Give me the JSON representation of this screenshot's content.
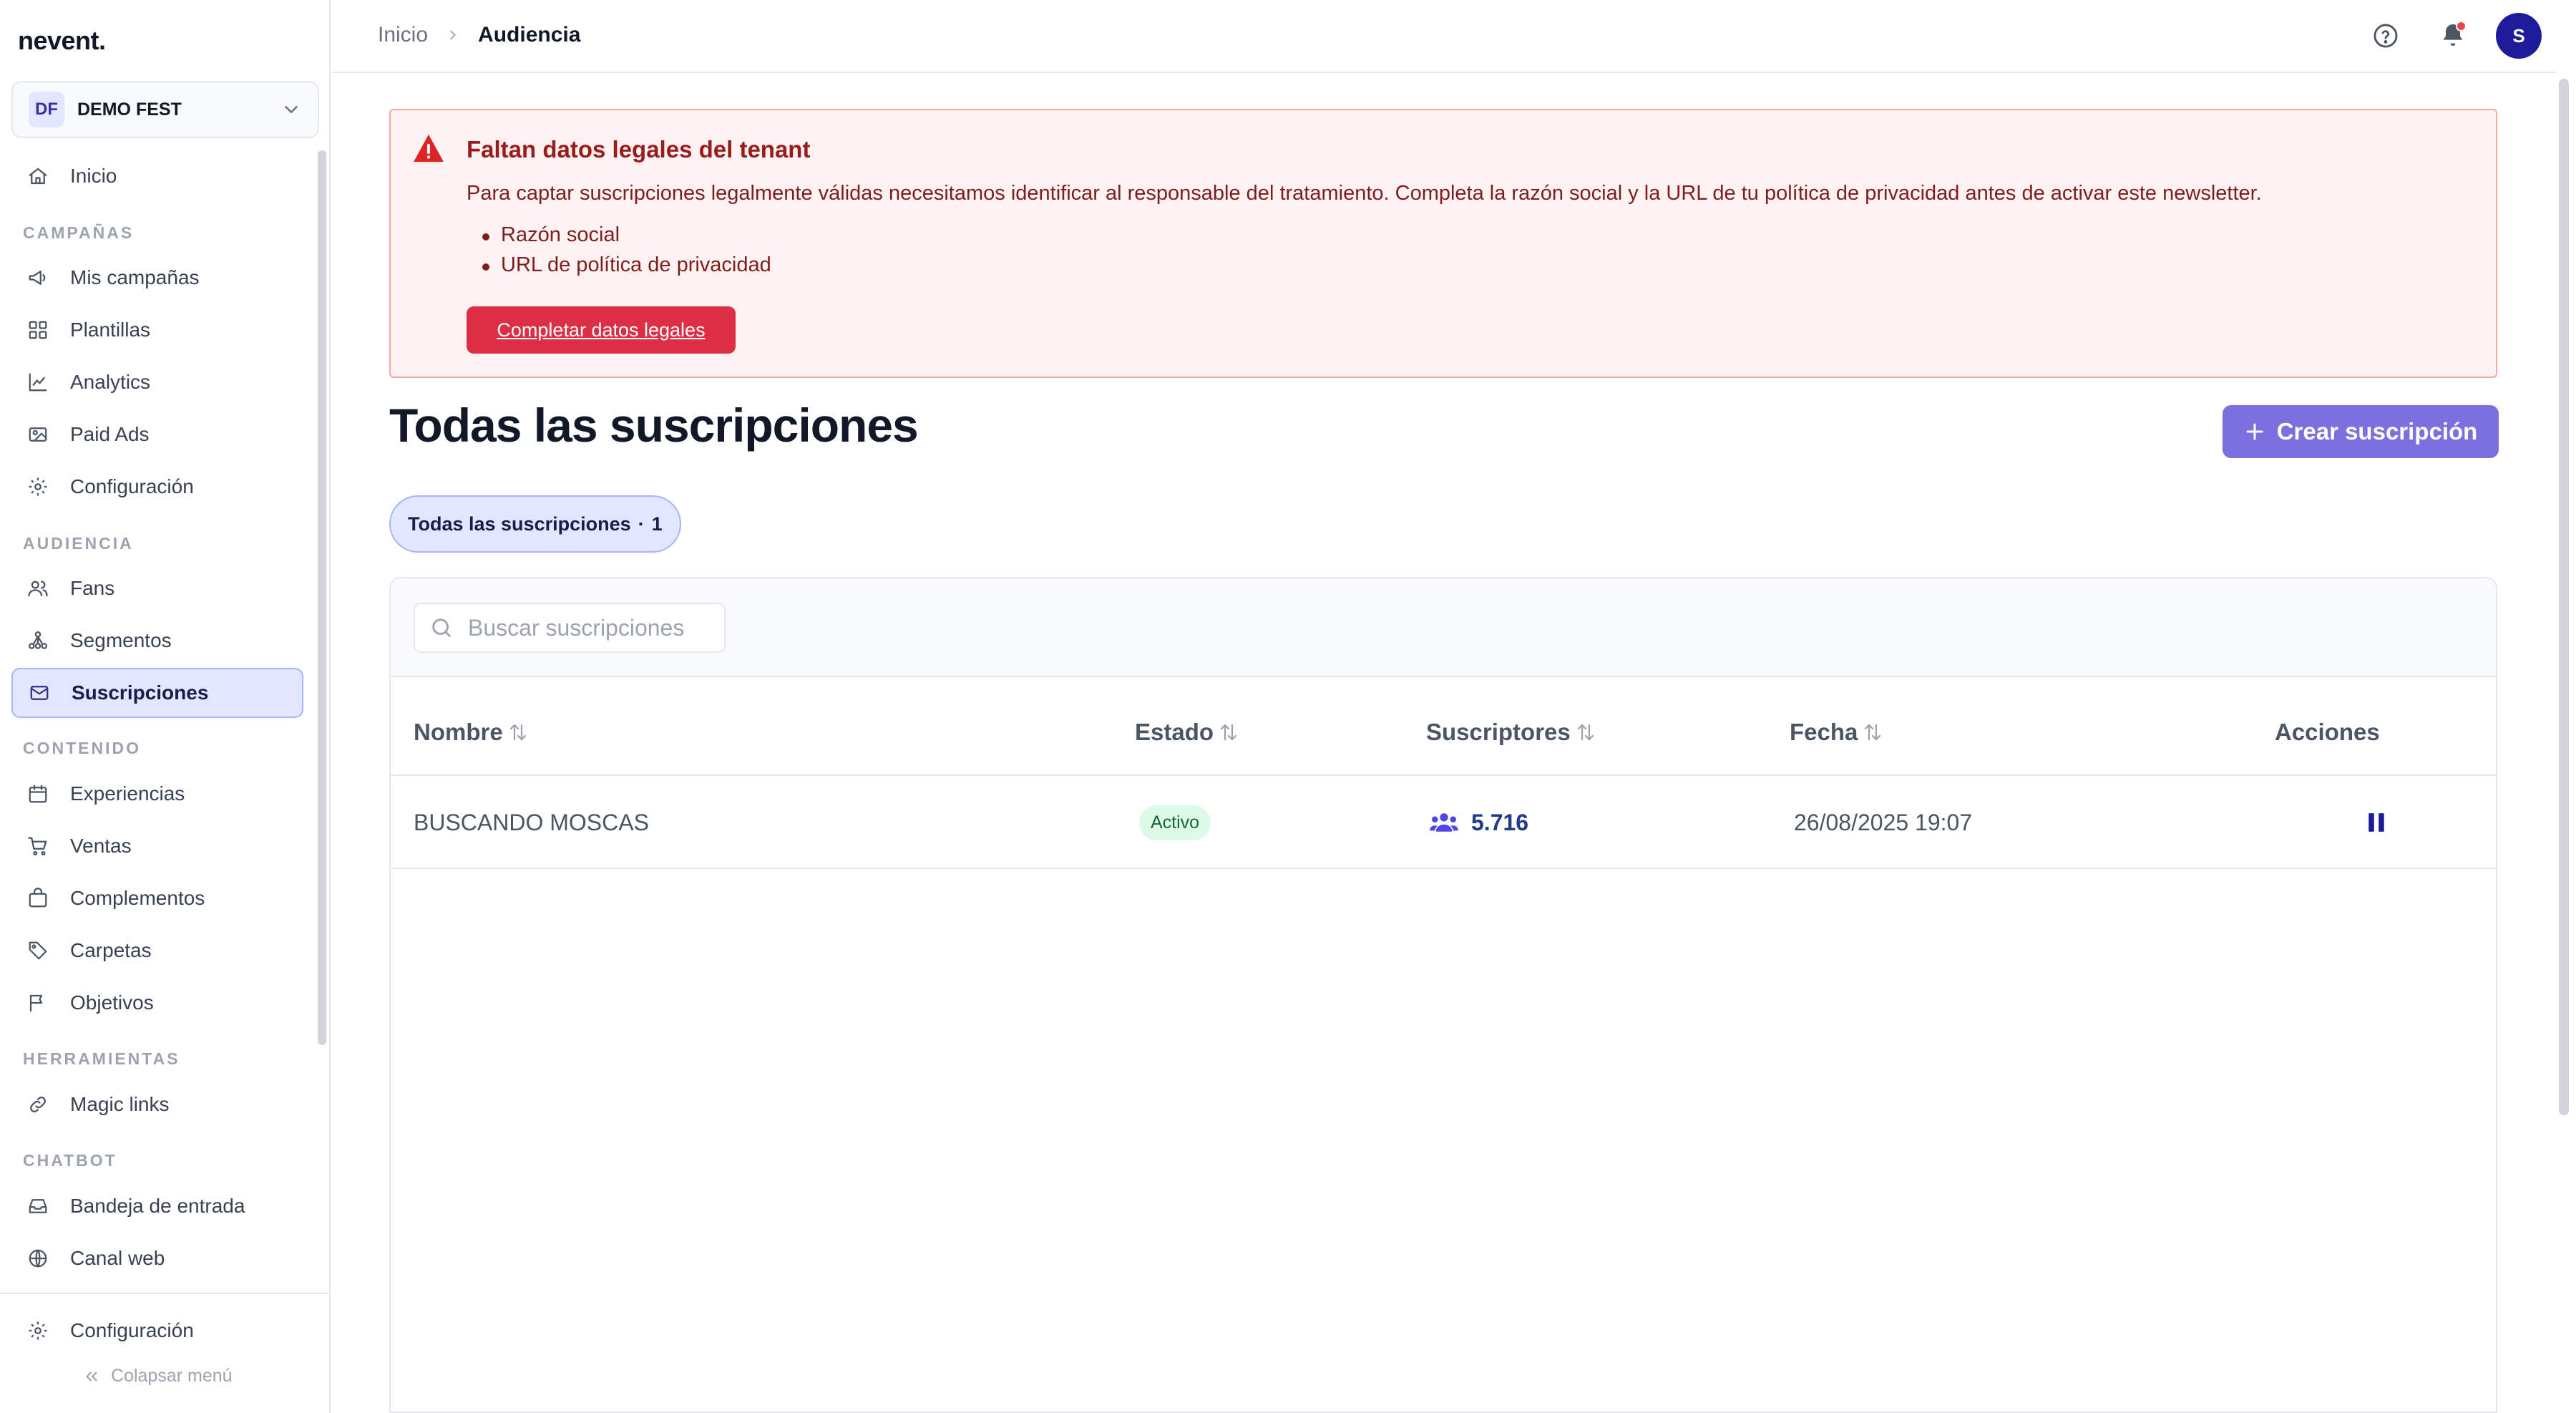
{
  "app": {
    "logo": "nevent."
  },
  "tenant": {
    "initials": "DF",
    "name": "DEMO FEST"
  },
  "sidebar": {
    "home": "Inicio",
    "sections": {
      "campaigns": "CAMPAÑAS",
      "audience": "AUDIENCIA",
      "content": "CONTENIDO",
      "tools": "HERRAMIENTAS",
      "chatbot": "CHATBOT"
    },
    "campaigns": [
      "Mis campañas",
      "Plantillas",
      "Analytics",
      "Paid Ads",
      "Configuración"
    ],
    "audience": [
      "Fans",
      "Segmentos",
      "Suscripciones"
    ],
    "content": [
      "Experiencias",
      "Ventas",
      "Complementos",
      "Carpetas",
      "Objetivos"
    ],
    "tools": [
      "Magic links"
    ],
    "chatbot": [
      "Bandeja de entrada",
      "Canal web"
    ],
    "footer_settings": "Configuración",
    "collapse": "Colapsar menú"
  },
  "breadcrumb": {
    "root": "Inicio",
    "current": "Audiencia"
  },
  "user": {
    "initial": "S"
  },
  "alert": {
    "title": "Faltan datos legales del tenant",
    "text": "Para captar suscripciones legalmente válidas necesitamos identificar al responsable del tratamiento. Completa la razón social y la URL de tu política de privacidad antes de activar este newsletter.",
    "items": [
      "Razón social",
      "URL de política de privacidad"
    ],
    "button": "Completar datos legales"
  },
  "page": {
    "title": "Todas las suscripciones",
    "create_button": "Crear suscripción"
  },
  "filter": {
    "label": "Todas las suscripciones",
    "separator": "·",
    "count": "1"
  },
  "search": {
    "placeholder": "Buscar suscripciones",
    "value": ""
  },
  "table": {
    "columns": {
      "name": "Nombre",
      "status": "Estado",
      "subscribers": "Suscriptores",
      "date": "Fecha",
      "actions": "Acciones"
    },
    "rows": [
      {
        "name": "BUSCANDO MOSCAS",
        "status": "Activo",
        "subscribers": "5.716",
        "date": "26/08/2025 19:07"
      }
    ]
  }
}
